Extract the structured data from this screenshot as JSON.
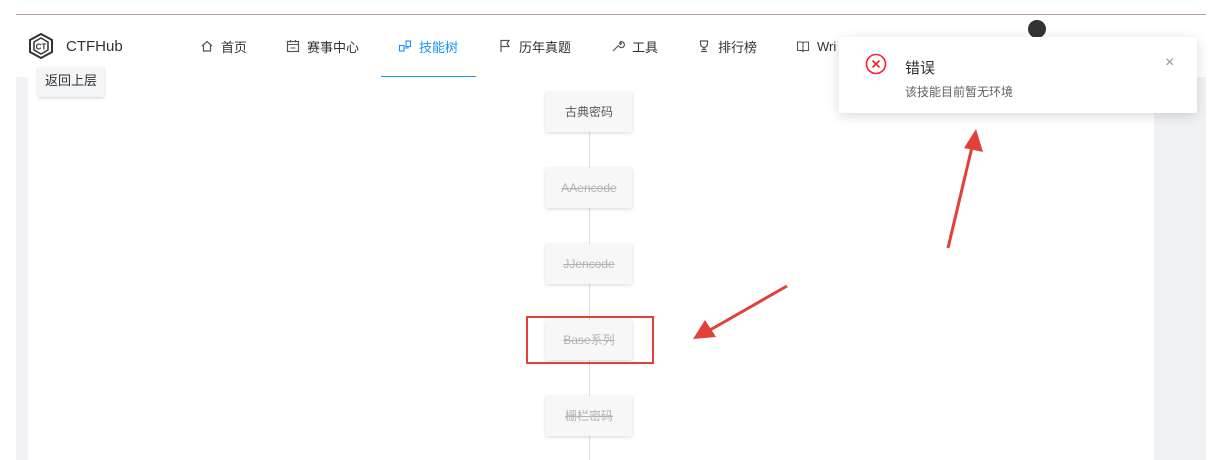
{
  "brand": {
    "name": "CTFHub"
  },
  "nav": {
    "items": [
      {
        "label": "首页",
        "icon": "home-icon"
      },
      {
        "label": "赛事中心",
        "icon": "calendar-icon"
      },
      {
        "label": "技能树",
        "icon": "skill-tree-icon",
        "active": true
      },
      {
        "label": "历年真题",
        "icon": "flag-icon"
      },
      {
        "label": "工具",
        "icon": "wrench-icon"
      },
      {
        "label": "排行榜",
        "icon": "trophy-icon"
      },
      {
        "label": "Wri",
        "icon": "book-icon"
      }
    ]
  },
  "back_button": {
    "label": "返回上层"
  },
  "tree": {
    "nodes": [
      {
        "label": "古典密码",
        "disabled": false
      },
      {
        "label": "AAencode",
        "disabled": true
      },
      {
        "label": "JJencode",
        "disabled": true
      },
      {
        "label": "Base系列",
        "disabled": true
      },
      {
        "label": "栅栏密码",
        "disabled": true
      }
    ]
  },
  "toast": {
    "title": "错误",
    "message": "该技能目前暂无环境",
    "close_glyph": "×",
    "icon": "error-circle-icon"
  },
  "colors": {
    "accent": "#1890ff",
    "error": "#f5222d",
    "annotation": "#e2413b"
  }
}
